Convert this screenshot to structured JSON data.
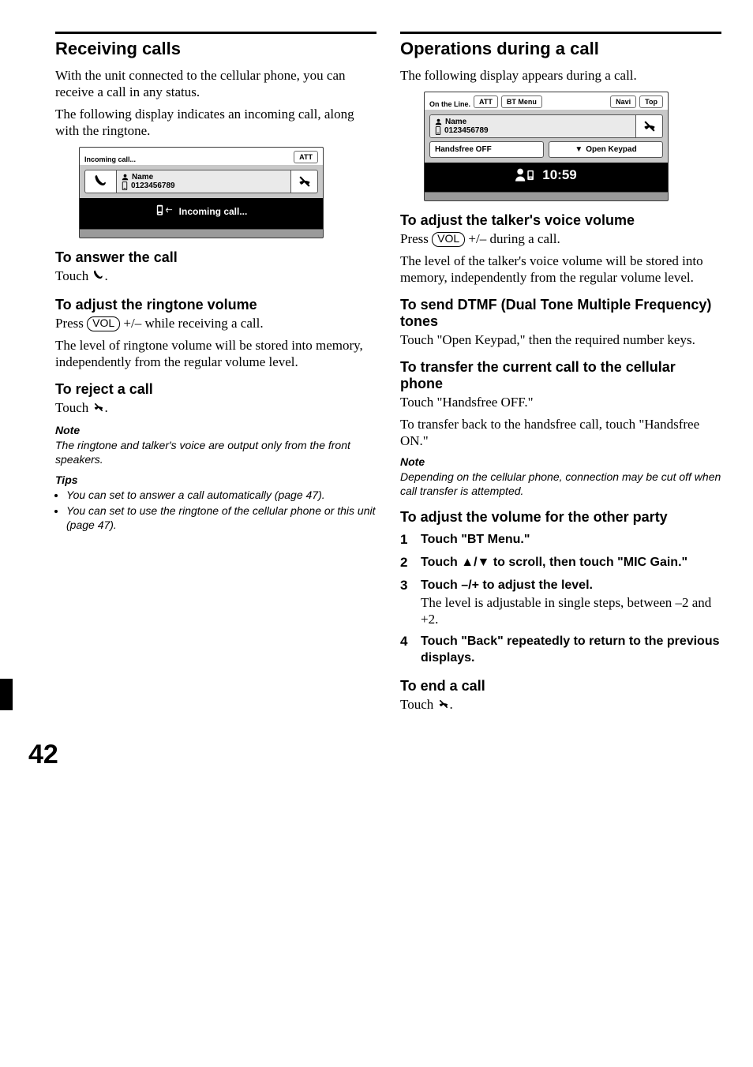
{
  "pageNumber": "42",
  "left": {
    "h2": "Receiving calls",
    "intro1": "With the unit connected to the cellular phone, you can receive a call in any status.",
    "intro2": "The following display indicates an incoming call, along with the ringtone.",
    "screen1": {
      "status": "Incoming call...",
      "att": "ATT",
      "name": "Name",
      "number": "0123456789",
      "banner": "Incoming call..."
    },
    "answer_h": "To answer the call",
    "answer_b": "Touch ",
    "answer_b2": ".",
    "ring_h": "To adjust the ringtone volume",
    "ring_b_a": "Press ",
    "vol": "VOL",
    "ring_b_b": " +/– while receiving a call.",
    "ring_b2": "The level of ringtone volume will be stored into memory, independently from the regular volume level.",
    "reject_h": "To reject a call",
    "reject_b": "Touch ",
    "reject_b2": ".",
    "note_hd": "Note",
    "note_body": "The ringtone and talker's voice are output only from the front speakers.",
    "tips_hd": "Tips",
    "tips": [
      "You can set to answer a call automatically (page 47).",
      "You can set to use the ringtone of the cellular phone or this unit (page 47)."
    ]
  },
  "right": {
    "h2": "Operations during a call",
    "intro": "The following display appears during a call.",
    "screen2": {
      "status": "On the Line.",
      "att": "ATT",
      "btmenu": "BT Menu",
      "navi": "Navi",
      "top": "Top",
      "name": "Name",
      "number": "0123456789",
      "hf": "Handsfree OFF",
      "openkp": "Open Keypad",
      "clock": "10:59"
    },
    "talker_h": "To adjust the talker's voice volume",
    "talker_b_a": "Press ",
    "talker_b_b": " +/– during a call.",
    "talker_b2": "The level of the talker's voice volume will be stored into memory, independently from the regular volume level.",
    "dtmf_h": "To send DTMF (Dual Tone Multiple Frequency) tones",
    "dtmf_b": "Touch \"Open Keypad,\" then the required number keys.",
    "transfer_h": "To transfer the current call to the cellular phone",
    "transfer_b1": "Touch \"Handsfree OFF.\"",
    "transfer_b2": "To transfer back to the handsfree call, touch \"Handsfree ON.\"",
    "note_hd": "Note",
    "note_body": "Depending on the cellular phone, connection may be cut off when call transfer is attempted.",
    "other_h": "To adjust the volume for the other party",
    "steps": [
      {
        "n": "1",
        "main": "Touch \"BT Menu.\""
      },
      {
        "n": "2",
        "main": "Touch ▲/▼ to scroll, then touch \"MIC Gain.\""
      },
      {
        "n": "3",
        "main": "Touch –/+ to adjust the level.",
        "sub": "The level is adjustable in single steps, between –2 and +2."
      },
      {
        "n": "4",
        "main": "Touch \"Back\" repeatedly to return to the previous displays."
      }
    ],
    "end_h": "To end a call",
    "end_b": "Touch ",
    "end_b2": "."
  }
}
